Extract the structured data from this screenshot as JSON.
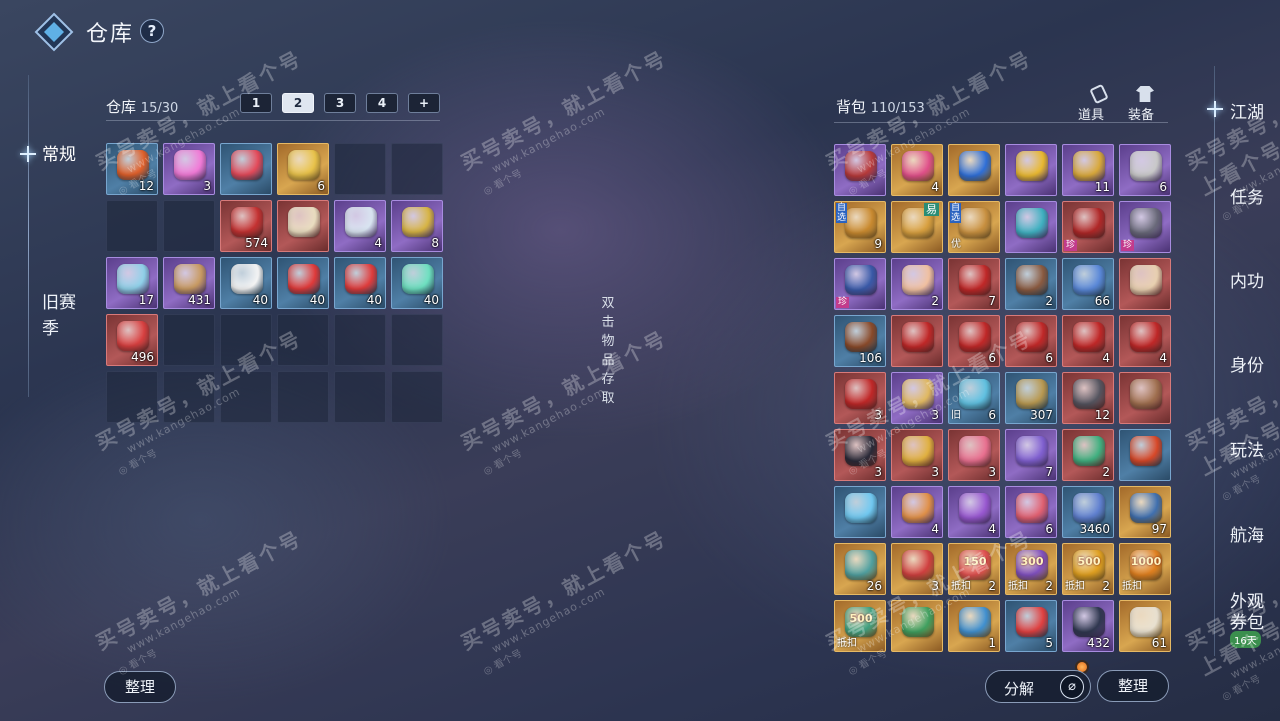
{
  "header": {
    "title": "仓库",
    "help": "?"
  },
  "left_nav": [
    "常规",
    "旧赛",
    "季"
  ],
  "warehouse": {
    "label": "仓库",
    "count": "15/30",
    "tabs": [
      "1",
      "2",
      "3",
      "4",
      "+"
    ],
    "rows": [
      [
        {
          "q": "blue",
          "c": "#e0602a",
          "n": "12"
        },
        {
          "q": "purple",
          "c": "#f07ad6",
          "n": "3"
        },
        {
          "q": "blue",
          "c": "#e44a5a",
          "n": ""
        },
        {
          "q": "gold",
          "c": "#e8c24a",
          "n": "6"
        },
        {
          "q": "",
          "n": ""
        },
        {
          "q": "",
          "n": ""
        }
      ],
      [
        {
          "q": "",
          "n": ""
        },
        {
          "q": "",
          "n": ""
        },
        {
          "q": "red",
          "c": "#c43232",
          "n": "574"
        },
        {
          "q": "red",
          "c": "#e9ddc0",
          "n": ""
        },
        {
          "q": "purple",
          "c": "#d8e4f0",
          "n": "4"
        },
        {
          "q": "purple",
          "c": "#d7b444",
          "n": "8"
        }
      ],
      [
        {
          "q": "purple",
          "c": "#8fd0e8",
          "n": "17"
        },
        {
          "q": "purple",
          "c": "#c89a62",
          "n": "431"
        },
        {
          "q": "blue",
          "c": "#f4f4f4",
          "n": "40"
        },
        {
          "q": "blue",
          "c": "#e03a3a",
          "n": "40"
        },
        {
          "q": "blue",
          "c": "#e03c3c",
          "n": "40"
        },
        {
          "q": "blue",
          "c": "#6ee0c0",
          "n": "40"
        }
      ],
      [
        {
          "q": "red",
          "c": "#d84040",
          "n": "496"
        },
        {
          "q": "",
          "n": ""
        },
        {
          "q": "",
          "n": ""
        },
        {
          "q": "",
          "n": ""
        },
        {
          "q": "",
          "n": ""
        },
        {
          "q": "",
          "n": ""
        }
      ],
      [
        {
          "q": "",
          "n": ""
        },
        {
          "q": "",
          "n": ""
        },
        {
          "q": "",
          "n": ""
        },
        {
          "q": "",
          "n": ""
        },
        {
          "q": "",
          "n": ""
        },
        {
          "q": "",
          "n": ""
        }
      ]
    ],
    "sort_btn": "整理"
  },
  "hint": [
    "双",
    "击",
    "物",
    "品",
    "存",
    "取"
  ],
  "bag": {
    "label": "背包",
    "count": "110/153",
    "subtabs": [
      "道具",
      "装备"
    ],
    "rows": [
      [
        {
          "q": "purple",
          "c": "#b83a3a",
          "n": ""
        },
        {
          "q": "gold",
          "c": "#e0508a",
          "n": "4"
        },
        {
          "q": "gold",
          "c": "#2f6fd8",
          "n": ""
        },
        {
          "q": "purple",
          "c": "#e8b830",
          "n": ""
        },
        {
          "q": "purple",
          "c": "#d8a83a",
          "n": "11"
        },
        {
          "q": "purple",
          "c": "#c8c8c8",
          "n": "6"
        }
      ],
      [
        {
          "q": "gold",
          "c": "#c98a30",
          "n": "9",
          "tag": "自选"
        },
        {
          "q": "gold",
          "c": "#d8a040",
          "n": "",
          "tagtr": "易"
        },
        {
          "q": "gold",
          "c": "#c89040",
          "n": "",
          "tag": "自选",
          "tagbl": "优"
        },
        {
          "q": "purple",
          "c": "#3fb0c0",
          "n": ""
        },
        {
          "q": "red",
          "c": "#b02828",
          "n": "",
          "tagr": "珍"
        },
        {
          "q": "purple",
          "c": "#6a6a7a",
          "n": "",
          "tagr": "珍"
        }
      ],
      [
        {
          "q": "purple",
          "c": "#3a5aa8",
          "n": "",
          "tagr": "珍"
        },
        {
          "q": "purple",
          "c": "#f0c0a0",
          "n": "2"
        },
        {
          "q": "red",
          "c": "#c02828",
          "n": "7"
        },
        {
          "q": "blue",
          "c": "#8a5a40",
          "n": "2"
        },
        {
          "q": "blue",
          "c": "#5a88d8",
          "n": "66"
        },
        {
          "q": "red",
          "c": "#e8d0b0",
          "n": ""
        }
      ],
      [
        {
          "q": "blue",
          "c": "#8a4a2a",
          "n": "106"
        },
        {
          "q": "red",
          "c": "#c02828",
          "n": ""
        },
        {
          "q": "red",
          "c": "#c02828",
          "n": "6"
        },
        {
          "q": "red",
          "c": "#c02828",
          "n": "6"
        },
        {
          "q": "red",
          "c": "#c02828",
          "n": "4"
        },
        {
          "q": "red",
          "c": "#c02828",
          "n": "4"
        }
      ],
      [
        {
          "q": "red",
          "c": "#c02828",
          "n": "3"
        },
        {
          "q": "purple",
          "c": "#e0b860",
          "n": "3"
        },
        {
          "q": "blue",
          "c": "#60c0e0",
          "n": "6",
          "tagbl": "旧"
        },
        {
          "q": "blue",
          "c": "#b89850",
          "n": "307"
        },
        {
          "q": "red",
          "c": "#555560",
          "n": "12"
        },
        {
          "q": "red",
          "c": "#a07050",
          "n": ""
        }
      ],
      [
        {
          "q": "red",
          "c": "#2a2a38",
          "n": "3"
        },
        {
          "q": "red",
          "c": "#e0b040",
          "n": "3"
        },
        {
          "q": "red",
          "c": "#e87090",
          "n": "3"
        },
        {
          "q": "purple",
          "c": "#8060d0",
          "n": "7"
        },
        {
          "q": "red",
          "c": "#40b080",
          "n": "2"
        },
        {
          "q": "blue",
          "c": "#d84828",
          "n": ""
        }
      ],
      [
        {
          "q": "blue",
          "c": "#70c8f0",
          "n": ""
        },
        {
          "q": "purple",
          "c": "#e09048",
          "n": "4"
        },
        {
          "q": "purple",
          "c": "#9858d0",
          "n": "4"
        },
        {
          "q": "purple",
          "c": "#e06070",
          "n": "6"
        },
        {
          "q": "blue",
          "c": "#6080d0",
          "n": "3460"
        },
        {
          "q": "gold",
          "c": "#4070b0",
          "n": "97"
        }
      ],
      [
        {
          "q": "gold",
          "c": "#50a0a0",
          "n": "26"
        },
        {
          "q": "gold",
          "c": "#d04040",
          "n": "3"
        },
        {
          "q": "gold",
          "c": "#e05050",
          "n": "2",
          "face": "150",
          "tagbl": "抵扣"
        },
        {
          "q": "gold",
          "c": "#8050c0",
          "n": "2",
          "face": "300",
          "tagbl": "抵扣"
        },
        {
          "q": "gold",
          "c": "#e0a020",
          "n": "2",
          "face": "500",
          "tagbl": "抵扣"
        },
        {
          "q": "gold",
          "c": "#e08020",
          "n": "",
          "face": "1000",
          "tagbl": "抵扣"
        }
      ],
      [
        {
          "q": "gold",
          "c": "#40a080",
          "n": "",
          "face": "500",
          "tagbl": "抵扣"
        },
        {
          "q": "gold",
          "c": "#40a060",
          "n": ""
        },
        {
          "q": "gold",
          "c": "#4090d0",
          "n": "1"
        },
        {
          "q": "blue",
          "c": "#e04040",
          "n": "5"
        },
        {
          "q": "purple",
          "c": "#303850",
          "n": "432"
        },
        {
          "q": "gold",
          "c": "#e8e0d0",
          "n": "61"
        }
      ]
    ],
    "decompose_btn": "分解",
    "sort_btn": "整理"
  },
  "right_nav": [
    "江湖",
    "任务",
    "内功",
    "身份",
    "玩法",
    "航海",
    "外观",
    "券包"
  ],
  "right_badge": "16天",
  "watermark": {
    "line1": "买号卖号，就上看个号",
    "line2": "www.kangehao.com",
    "line3": "看个号"
  }
}
